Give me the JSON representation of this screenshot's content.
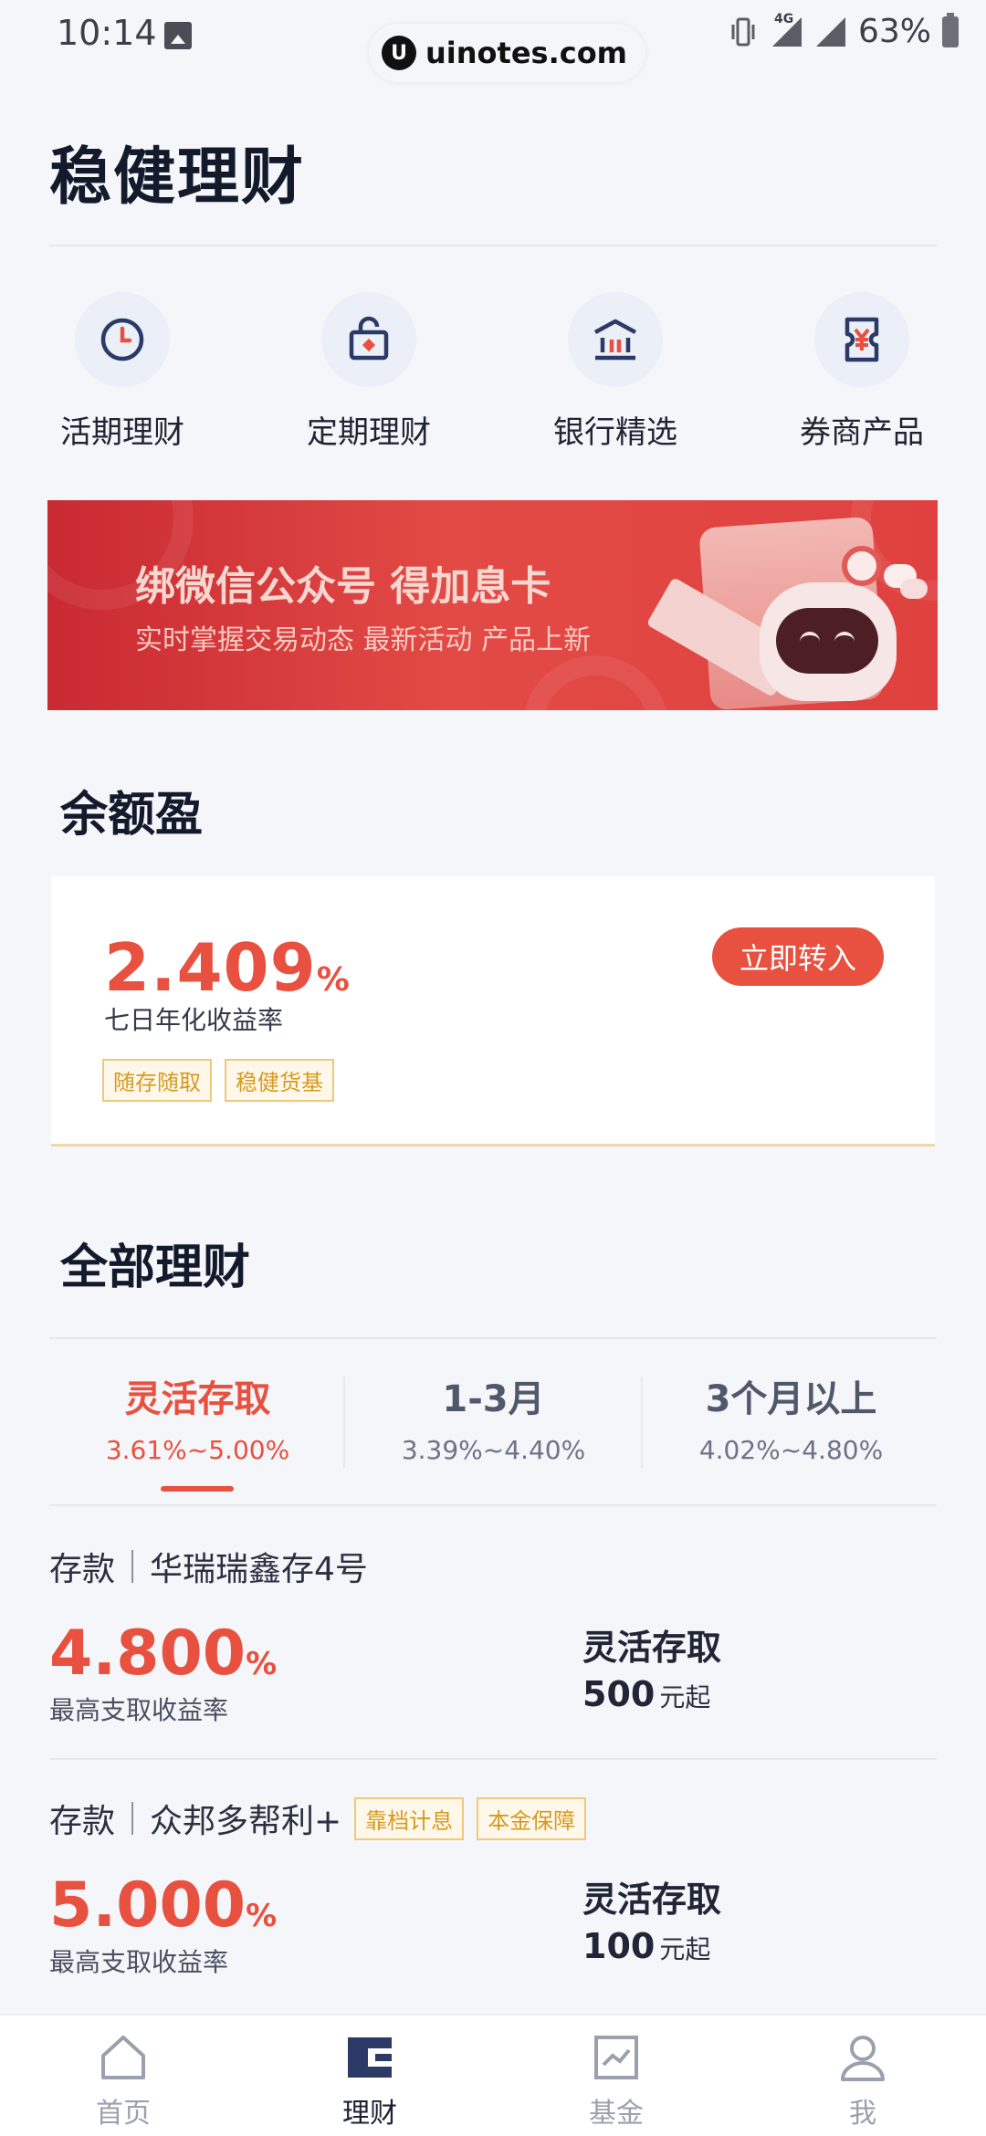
{
  "status_bar": {
    "time": "10:14",
    "network": "4G",
    "battery": "63%",
    "watermark": "uinotes.com",
    "watermark_logo": "U"
  },
  "page": {
    "title": "稳健理财"
  },
  "categories": [
    {
      "label": "活期理财",
      "icon": "clock-icon"
    },
    {
      "label": "定期理财",
      "icon": "lock-box-icon"
    },
    {
      "label": "银行精选",
      "icon": "bank-icon"
    },
    {
      "label": "券商产品",
      "icon": "yen-ticket-icon"
    }
  ],
  "banner": {
    "title": "绑微信公众号 得加息卡",
    "subtitle": "实时掌握交易动态 最新活动 产品上新"
  },
  "yue": {
    "section_title": "余额盈",
    "rate": "2.409",
    "rate_unit": "%",
    "rate_label": "七日年化收益率",
    "tags": [
      "随存随取",
      "稳健货基"
    ],
    "cta": "立即转入"
  },
  "all": {
    "section_title": "全部理财",
    "tabs": [
      {
        "label": "灵活存取",
        "range": "3.61%~5.00%",
        "active": true
      },
      {
        "label": "1-3月",
        "range": "3.39%~4.40%",
        "active": false
      },
      {
        "label": "3个月以上",
        "range": "4.02%~4.80%",
        "active": false
      }
    ],
    "products": [
      {
        "category": "存款",
        "name": "华瑞瑞鑫存4号",
        "tags": [],
        "rate": "4.800",
        "rate_unit": "%",
        "rate_label": "最高支取收益率",
        "type": "灵活存取",
        "min": "500",
        "min_unit": "元起"
      },
      {
        "category": "存款",
        "name": "众邦多帮利+",
        "tags": [
          "靠档计息",
          "本金保障"
        ],
        "rate": "5.000",
        "rate_unit": "%",
        "rate_label": "最高支取收益率",
        "type": "灵活存取",
        "min": "100",
        "min_unit": "元起"
      }
    ]
  },
  "bottom_nav": [
    {
      "label": "首页",
      "icon": "home-icon",
      "active": false
    },
    {
      "label": "理财",
      "icon": "wallet-icon",
      "active": true
    },
    {
      "label": "基金",
      "icon": "chart-icon",
      "active": false
    },
    {
      "label": "我",
      "icon": "user-icon",
      "active": false
    }
  ],
  "colors": {
    "accent": "#e8503f",
    "tag_border": "#eec97a",
    "tag_text": "#d59a20",
    "icon_blue": "#2b3a67"
  }
}
